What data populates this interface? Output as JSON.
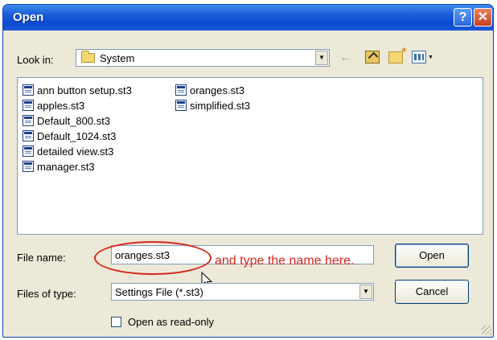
{
  "window": {
    "title": "Open"
  },
  "titlebar": {
    "help_glyph": "?",
    "close_glyph": "✕"
  },
  "look_in": {
    "label": "Look in:",
    "value": "System",
    "icon": "folder-icon"
  },
  "toolbar": {
    "back_icon": "back-arrow-icon",
    "up_icon": "up-one-level-icon",
    "new_folder_icon": "new-folder-icon",
    "views_icon": "views-menu-icon"
  },
  "files": [
    {
      "name": "ann button setup.st3"
    },
    {
      "name": "apples.st3"
    },
    {
      "name": "Default_800.st3"
    },
    {
      "name": "Default_1024.st3"
    },
    {
      "name": "detailed view.st3"
    },
    {
      "name": "manager.st3"
    },
    {
      "name": "oranges.st3"
    },
    {
      "name": "simplified.st3"
    }
  ],
  "file_name": {
    "label": "File name:",
    "value": "oranges.st3"
  },
  "files_of_type": {
    "label": "Files of type:",
    "value": "Settings File (*.st3)"
  },
  "buttons": {
    "open": "Open",
    "cancel": "Cancel"
  },
  "read_only": {
    "label": "Open as read-only",
    "checked": false
  },
  "annotation": {
    "text": "and type the name here.",
    "color": "#d6281e"
  },
  "colors": {
    "title_bar": "#0a4ad0",
    "dialog_bg": "#ece9d8",
    "annotation": "#d6281e"
  }
}
